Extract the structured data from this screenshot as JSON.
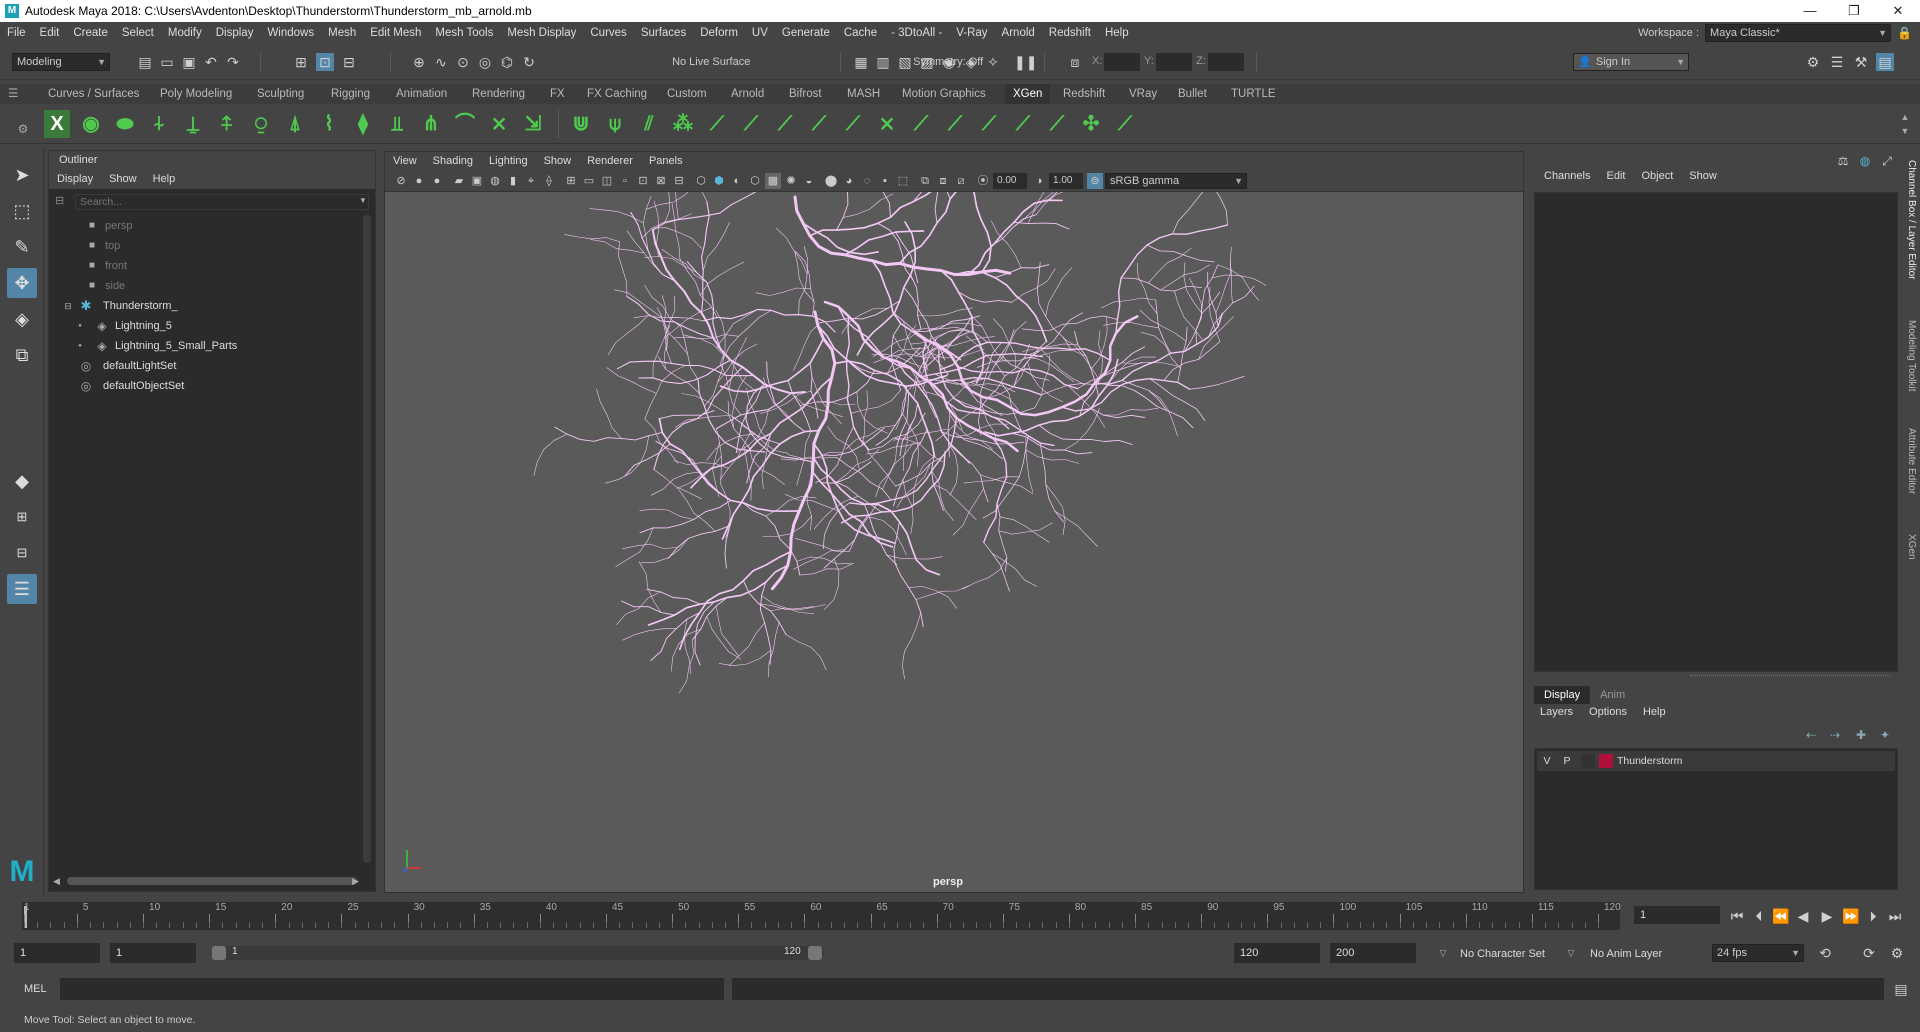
{
  "window": {
    "title": "Autodesk Maya 2018: C:\\Users\\Avdenton\\Desktop\\Thunderstorm\\Thunderstorm_mb_arnold.mb",
    "controls": [
      "—",
      "❐",
      "✕"
    ]
  },
  "menubar": {
    "items": [
      "File",
      "Edit",
      "Create",
      "Select",
      "Modify",
      "Display",
      "Windows",
      "Mesh",
      "Edit Mesh",
      "Mesh Tools",
      "Mesh Display",
      "Curves",
      "Surfaces",
      "Deform",
      "UV",
      "Generate",
      "Cache",
      "- 3DtoAll -",
      "V-Ray",
      "Arnold",
      "Redshift",
      "Help"
    ],
    "workspace_label": "Workspace :",
    "workspace_value": "Maya Classic*"
  },
  "statusline": {
    "mode": "Modeling",
    "live_surface": "No Live Surface",
    "symmetry": "Symmetry: Off",
    "x_label": "X:",
    "y_label": "Y:",
    "z_label": "Z:",
    "sign_in": "Sign In"
  },
  "shelf": {
    "tabs": [
      "Curves / Surfaces",
      "Poly Modeling",
      "Sculpting",
      "Rigging",
      "Animation",
      "Rendering",
      "FX",
      "FX Caching",
      "Custom",
      "Arnold",
      "Bifrost",
      "MASH",
      "Motion Graphics",
      "XGen",
      "Redshift",
      "VRay",
      "Bullet",
      "TURTLE"
    ],
    "active_tab": "XGen",
    "icon_color": "#4ecb4e"
  },
  "outliner": {
    "title": "Outliner",
    "menu": [
      "Display",
      "Show",
      "Help"
    ],
    "search_placeholder": "Search...",
    "items": [
      {
        "label": "persp",
        "icon": "camera-icon",
        "dim": true
      },
      {
        "label": "top",
        "icon": "camera-icon",
        "dim": true
      },
      {
        "label": "front",
        "icon": "camera-icon",
        "dim": true
      },
      {
        "label": "side",
        "icon": "camera-icon",
        "dim": true
      },
      {
        "label": "Thunderstorm_",
        "icon": "group-icon",
        "dim": false
      },
      {
        "label": "Lightning_5",
        "icon": "mesh-icon",
        "dim": false
      },
      {
        "label": "Lightning_5_Small_Parts",
        "icon": "mesh-icon",
        "dim": false
      },
      {
        "label": "defaultLightSet",
        "icon": "set-icon",
        "dim": false
      },
      {
        "label": "defaultObjectSet",
        "icon": "set-icon",
        "dim": false
      }
    ]
  },
  "viewport": {
    "menu": [
      "View",
      "Shading",
      "Lighting",
      "Show",
      "Renderer",
      "Panels"
    ],
    "exposure": "0.00",
    "gamma": "1.00",
    "color_space": "sRGB gamma",
    "camera_label": "persp",
    "lightning_color": "#f3c8f5",
    "background_color": "#5a5a5a"
  },
  "channelbox": {
    "menu": [
      "Channels",
      "Edit",
      "Object",
      "Show"
    ]
  },
  "layereditor": {
    "tabs": [
      "Display",
      "Anim"
    ],
    "menu": [
      "Layers",
      "Options",
      "Help"
    ],
    "layer": {
      "v": "V",
      "p": "P",
      "name": "Thunderstorm",
      "color": "#b0103a"
    }
  },
  "sidetabs": [
    "Channel Box / Layer Editor",
    "Modeling Toolkit",
    "Attribute Editor",
    "XGen"
  ],
  "timeslider": {
    "ticks": [
      "1",
      "5",
      "10",
      "15",
      "20",
      "25",
      "30",
      "35",
      "40",
      "45",
      "50",
      "55",
      "60",
      "65",
      "70",
      "75",
      "80",
      "85",
      "90",
      "95",
      "100",
      "105",
      "110",
      "115",
      "120"
    ],
    "current_frame": "1"
  },
  "rangebar": {
    "start": "1",
    "playback_start": "1",
    "slider_start": "1",
    "slider_end": "120",
    "playback_end": "120",
    "end": "200",
    "character_set": "No Character Set",
    "anim_layer": "No Anim Layer",
    "fps": "24 fps"
  },
  "cmdline": {
    "label": "MEL"
  },
  "helpline": {
    "text": "Move Tool: Select an object to move."
  }
}
